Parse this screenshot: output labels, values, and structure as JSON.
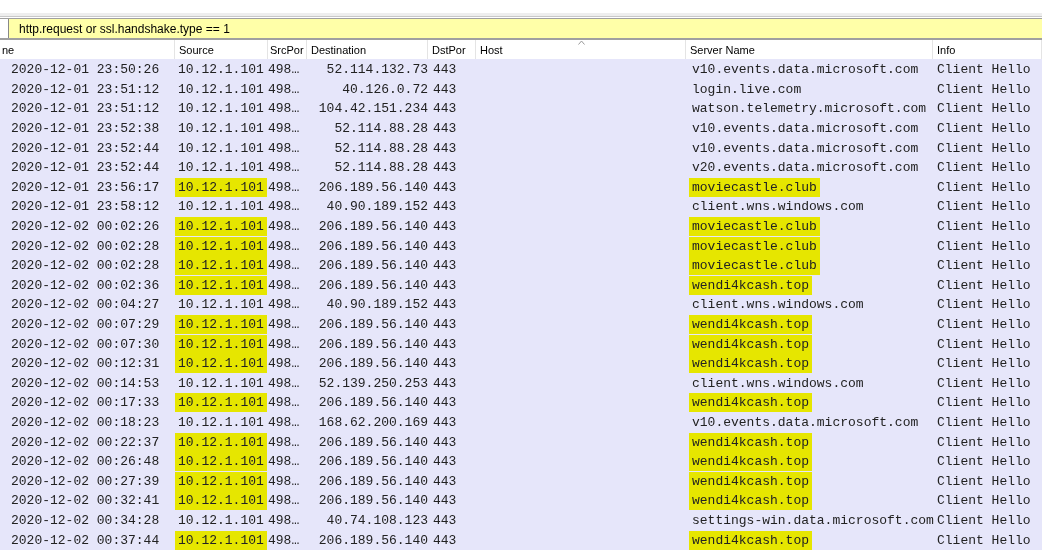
{
  "filter": {
    "value": "http.request or ssl.handshake.type == 1"
  },
  "table": {
    "columns": [
      "ne",
      "Source",
      "SrcPor",
      "Destination",
      "DstPor",
      "Host",
      "Server Name",
      "Info"
    ],
    "rows": [
      {
        "time": "2020-12-01 23:50:26",
        "source": "10.12.1.101",
        "src_port": "498…",
        "destination": "52.114.132.73",
        "dst_port": "443",
        "server_name": "v10.events.data.microsoft.com",
        "info": "Client Hello",
        "highlighted": false
      },
      {
        "time": "2020-12-01 23:51:12",
        "source": "10.12.1.101",
        "src_port": "498…",
        "destination": "40.126.0.72",
        "dst_port": "443",
        "server_name": "login.live.com",
        "info": "Client Hello",
        "highlighted": false
      },
      {
        "time": "2020-12-01 23:51:12",
        "source": "10.12.1.101",
        "src_port": "498…",
        "destination": "104.42.151.234",
        "dst_port": "443",
        "server_name": "watson.telemetry.microsoft.com",
        "info": "Client Hello",
        "highlighted": false
      },
      {
        "time": "2020-12-01 23:52:38",
        "source": "10.12.1.101",
        "src_port": "498…",
        "destination": "52.114.88.28",
        "dst_port": "443",
        "server_name": "v10.events.data.microsoft.com",
        "info": "Client Hello",
        "highlighted": false
      },
      {
        "time": "2020-12-01 23:52:44",
        "source": "10.12.1.101",
        "src_port": "498…",
        "destination": "52.114.88.28",
        "dst_port": "443",
        "server_name": "v10.events.data.microsoft.com",
        "info": "Client Hello",
        "highlighted": false
      },
      {
        "time": "2020-12-01 23:52:44",
        "source": "10.12.1.101",
        "src_port": "498…",
        "destination": "52.114.88.28",
        "dst_port": "443",
        "server_name": "v20.events.data.microsoft.com",
        "info": "Client Hello",
        "highlighted": false
      },
      {
        "time": "2020-12-01 23:56:17",
        "source": "10.12.1.101",
        "src_port": "498…",
        "destination": "206.189.56.140",
        "dst_port": "443",
        "server_name": "moviecastle.club",
        "info": "Client Hello",
        "highlighted": true
      },
      {
        "time": "2020-12-01 23:58:12",
        "source": "10.12.1.101",
        "src_port": "498…",
        "destination": "40.90.189.152",
        "dst_port": "443",
        "server_name": "client.wns.windows.com",
        "info": "Client Hello",
        "highlighted": false
      },
      {
        "time": "2020-12-02 00:02:26",
        "source": "10.12.1.101",
        "src_port": "498…",
        "destination": "206.189.56.140",
        "dst_port": "443",
        "server_name": "moviecastle.club",
        "info": "Client Hello",
        "highlighted": true
      },
      {
        "time": "2020-12-02 00:02:28",
        "source": "10.12.1.101",
        "src_port": "498…",
        "destination": "206.189.56.140",
        "dst_port": "443",
        "server_name": "moviecastle.club",
        "info": "Client Hello",
        "highlighted": true
      },
      {
        "time": "2020-12-02 00:02:28",
        "source": "10.12.1.101",
        "src_port": "498…",
        "destination": "206.189.56.140",
        "dst_port": "443",
        "server_name": "moviecastle.club",
        "info": "Client Hello",
        "highlighted": true
      },
      {
        "time": "2020-12-02 00:02:36",
        "source": "10.12.1.101",
        "src_port": "498…",
        "destination": "206.189.56.140",
        "dst_port": "443",
        "server_name": "wendi4kcash.top",
        "info": "Client Hello",
        "highlighted": true
      },
      {
        "time": "2020-12-02 00:04:27",
        "source": "10.12.1.101",
        "src_port": "498…",
        "destination": "40.90.189.152",
        "dst_port": "443",
        "server_name": "client.wns.windows.com",
        "info": "Client Hello",
        "highlighted": false
      },
      {
        "time": "2020-12-02 00:07:29",
        "source": "10.12.1.101",
        "src_port": "498…",
        "destination": "206.189.56.140",
        "dst_port": "443",
        "server_name": "wendi4kcash.top",
        "info": "Client Hello",
        "highlighted": true
      },
      {
        "time": "2020-12-02 00:07:30",
        "source": "10.12.1.101",
        "src_port": "498…",
        "destination": "206.189.56.140",
        "dst_port": "443",
        "server_name": "wendi4kcash.top",
        "info": "Client Hello",
        "highlighted": true
      },
      {
        "time": "2020-12-02 00:12:31",
        "source": "10.12.1.101",
        "src_port": "498…",
        "destination": "206.189.56.140",
        "dst_port": "443",
        "server_name": "wendi4kcash.top",
        "info": "Client Hello",
        "highlighted": true
      },
      {
        "time": "2020-12-02 00:14:53",
        "source": "10.12.1.101",
        "src_port": "498…",
        "destination": "52.139.250.253",
        "dst_port": "443",
        "server_name": "client.wns.windows.com",
        "info": "Client Hello",
        "highlighted": false
      },
      {
        "time": "2020-12-02 00:17:33",
        "source": "10.12.1.101",
        "src_port": "498…",
        "destination": "206.189.56.140",
        "dst_port": "443",
        "server_name": "wendi4kcash.top",
        "info": "Client Hello",
        "highlighted": true
      },
      {
        "time": "2020-12-02 00:18:23",
        "source": "10.12.1.101",
        "src_port": "498…",
        "destination": "168.62.200.169",
        "dst_port": "443",
        "server_name": "v10.events.data.microsoft.com",
        "info": "Client Hello",
        "highlighted": false
      },
      {
        "time": "2020-12-02 00:22:37",
        "source": "10.12.1.101",
        "src_port": "498…",
        "destination": "206.189.56.140",
        "dst_port": "443",
        "server_name": "wendi4kcash.top",
        "info": "Client Hello",
        "highlighted": true
      },
      {
        "time": "2020-12-02 00:26:48",
        "source": "10.12.1.101",
        "src_port": "498…",
        "destination": "206.189.56.140",
        "dst_port": "443",
        "server_name": "wendi4kcash.top",
        "info": "Client Hello",
        "highlighted": true
      },
      {
        "time": "2020-12-02 00:27:39",
        "source": "10.12.1.101",
        "src_port": "498…",
        "destination": "206.189.56.140",
        "dst_port": "443",
        "server_name": "wendi4kcash.top",
        "info": "Client Hello",
        "highlighted": true
      },
      {
        "time": "2020-12-02 00:32:41",
        "source": "10.12.1.101",
        "src_port": "498…",
        "destination": "206.189.56.140",
        "dst_port": "443",
        "server_name": "wendi4kcash.top",
        "info": "Client Hello",
        "highlighted": true
      },
      {
        "time": "2020-12-02 00:34:28",
        "source": "10.12.1.101",
        "src_port": "498…",
        "destination": "40.74.108.123",
        "dst_port": "443",
        "server_name": "settings-win.data.microsoft.com",
        "info": "Client Hello",
        "highlighted": false
      },
      {
        "time": "2020-12-02 00:37:44",
        "source": "10.12.1.101",
        "src_port": "498…",
        "destination": "206.189.56.140",
        "dst_port": "443",
        "server_name": "wendi4kcash.top",
        "info": "Client Hello",
        "highlighted": true
      }
    ]
  }
}
